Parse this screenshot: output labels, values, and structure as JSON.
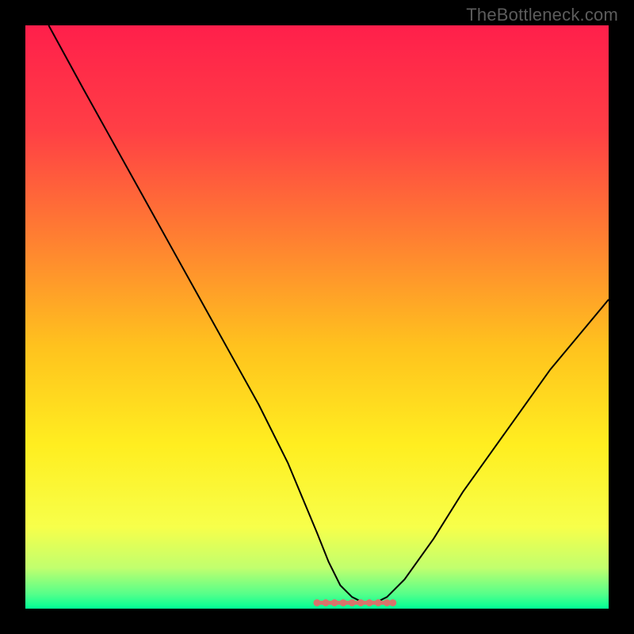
{
  "watermark": "TheBottleneck.com",
  "colors": {
    "frame": "#000000",
    "curve": "#000000",
    "marker_fill": "#d9736b",
    "marker_stroke": "#d9736b",
    "gradient_stops": [
      {
        "offset": 0.0,
        "color": "#ff1f4b"
      },
      {
        "offset": 0.18,
        "color": "#ff3f45"
      },
      {
        "offset": 0.35,
        "color": "#ff7a33"
      },
      {
        "offset": 0.55,
        "color": "#ffc21e"
      },
      {
        "offset": 0.72,
        "color": "#ffee20"
      },
      {
        "offset": 0.86,
        "color": "#f7ff4a"
      },
      {
        "offset": 0.93,
        "color": "#c1ff6e"
      },
      {
        "offset": 0.975,
        "color": "#55ff8a"
      },
      {
        "offset": 1.0,
        "color": "#00ff95"
      }
    ]
  },
  "chart_data": {
    "type": "line",
    "title": "",
    "xlabel": "",
    "ylabel": "",
    "xlim": [
      0,
      100
    ],
    "ylim": [
      0,
      100
    ],
    "x": [
      4,
      10,
      15,
      20,
      25,
      30,
      35,
      40,
      45,
      50,
      52,
      54,
      56,
      58,
      60,
      62,
      65,
      70,
      75,
      80,
      85,
      90,
      95,
      100
    ],
    "values": [
      100,
      89,
      80,
      71,
      62,
      53,
      44,
      35,
      25,
      13,
      8,
      4,
      2,
      1,
      1,
      2,
      5,
      12,
      20,
      27,
      34,
      41,
      47,
      53
    ],
    "flat_region": {
      "x_start": 50,
      "x_end": 63,
      "y": 1
    },
    "flat_markers_x": [
      50,
      51.5,
      53,
      54.5,
      56,
      57.5,
      59,
      60.5,
      62,
      63
    ],
    "annotations": []
  }
}
